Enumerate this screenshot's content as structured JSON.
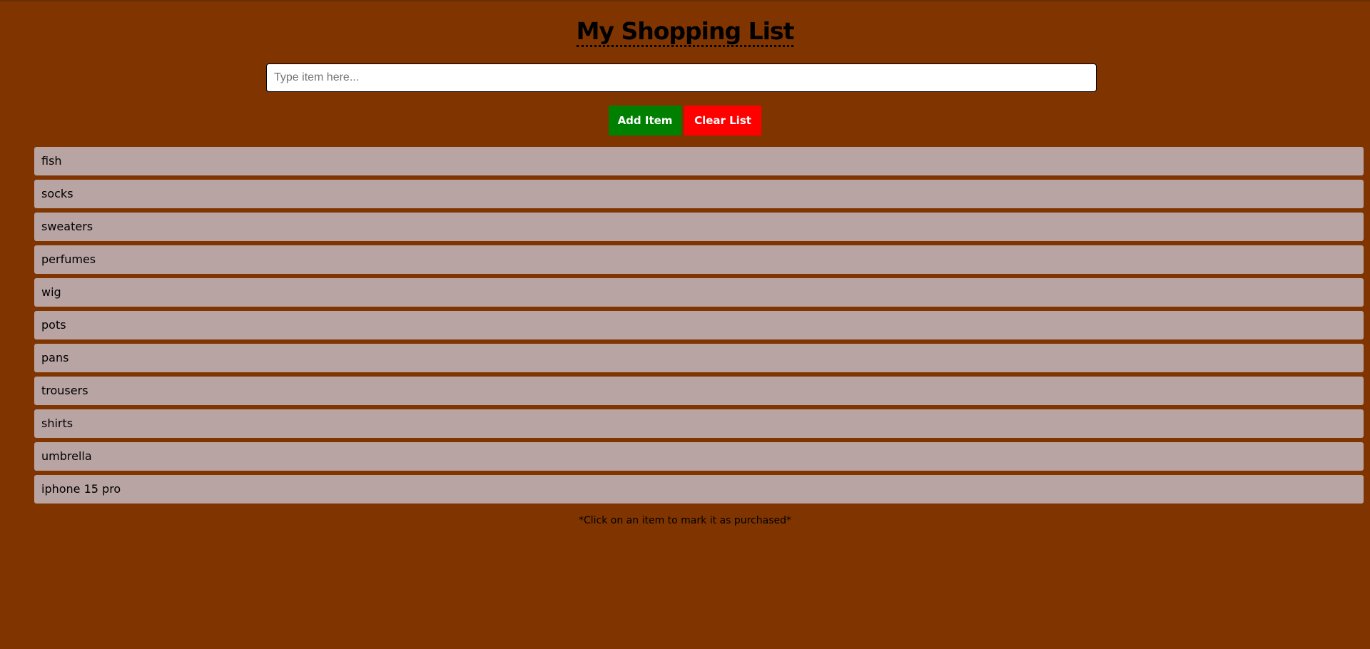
{
  "header": {
    "title": "My Shopping List"
  },
  "input": {
    "placeholder": "Type item here...",
    "value": ""
  },
  "buttons": {
    "add_label": "Add Item",
    "clear_label": "Clear List"
  },
  "list": {
    "items": [
      "fish",
      "socks",
      "sweaters",
      "perfumes",
      "wig",
      "pots",
      "pans",
      "trousers",
      "shirts",
      "umbrella",
      "iphone 15 pro"
    ]
  },
  "footer": {
    "hint": "*Click on an item to mark it as purchased*"
  },
  "colors": {
    "background": "#803500",
    "add_button": "#008000",
    "clear_button": "#ff0000",
    "list_item": "#b9a4a4"
  }
}
